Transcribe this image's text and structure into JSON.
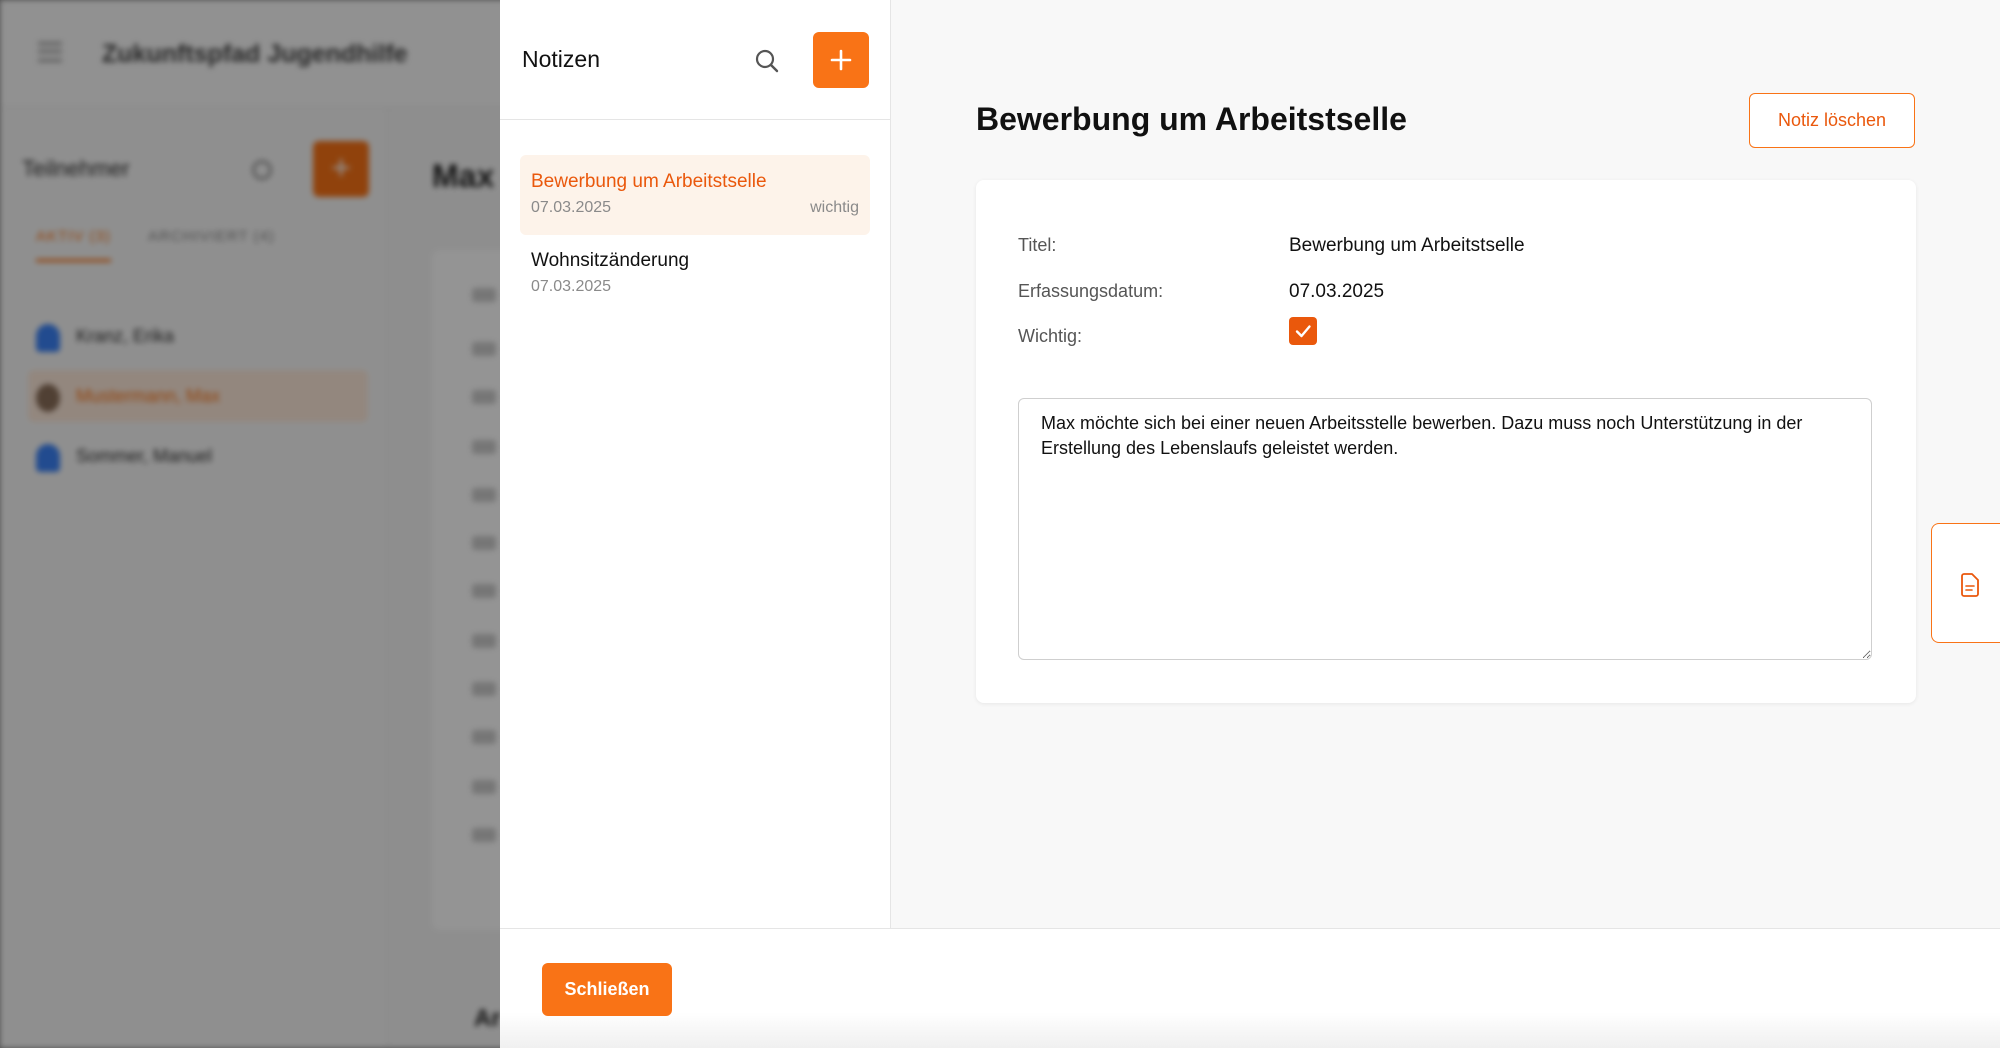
{
  "background": {
    "app_title": "Zukunftspfad Jugendhilfe",
    "sidebar_title": "Teilnehmer",
    "tabs": [
      "AKTIV (3)",
      "ARCHIVIERT (4)"
    ],
    "participants": [
      "Kranz, Erika",
      "Mustermann, Max",
      "Sommer, Manuel"
    ],
    "main_title": "Max",
    "bottom_title": "Ar"
  },
  "notes_panel": {
    "title": "Notizen",
    "search_icon": "search-icon",
    "add_icon": "plus-icon",
    "items": [
      {
        "title": "Bewerbung um Arbeitstselle",
        "date": "07.03.2025",
        "flag": "wichtig",
        "active": true
      },
      {
        "title": "Wohnsitzänderung",
        "date": "07.03.2025",
        "flag": "",
        "active": false
      }
    ]
  },
  "detail": {
    "title": "Bewerbung um Arbeitstselle",
    "delete_label": "Notiz löschen",
    "fields": {
      "title_label": "Titel:",
      "title_value": "Bewerbung um Arbeitstselle",
      "date_label": "Erfassungsdatum:",
      "date_value": "07.03.2025",
      "important_label": "Wichtig:",
      "important_checked": true
    },
    "text": "Max möchte sich bei einer neuen Arbeitsstelle bewerben. Dazu muss noch Unterstützung in der Erstellung des Lebenslaufs geleistet werden."
  },
  "side_tab_icon": "document-icon",
  "footer": {
    "close_label": "Schließen"
  },
  "colors": {
    "accent": "#f97316",
    "accent_dark": "#ea580c",
    "active_item_bg": "#fdf3ea"
  }
}
